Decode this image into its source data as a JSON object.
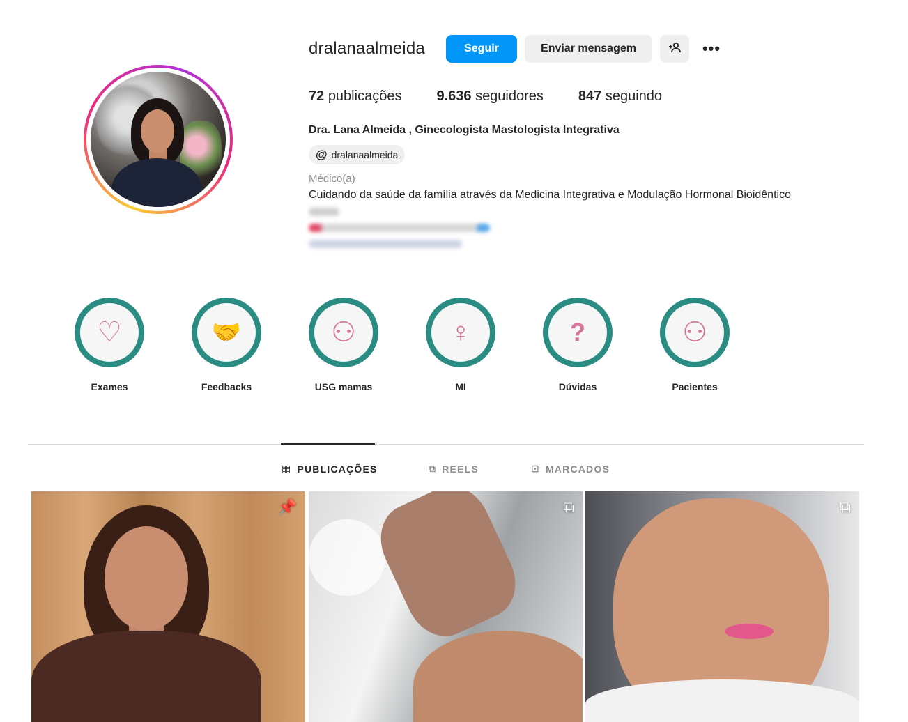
{
  "profile": {
    "username": "dralanaalmeida",
    "follow_label": "Seguir",
    "message_label": "Enviar mensagem",
    "add_user_icon": "+8",
    "more_icon": "•••",
    "stats": {
      "posts_count": "72",
      "posts_label": "publicações",
      "followers_count": "9.636",
      "followers_label": "seguidores",
      "following_count": "847",
      "following_label": "seguindo"
    },
    "full_name": "Dra. Lana Almeida , Ginecologista Mastologista Integrativa",
    "threads_handle": "dralanaalmeida",
    "category": "Médico(a)",
    "bio": "Cuidando da saúde da família através da Medicina Integrativa e Modulação Hormonal Bioidêntico"
  },
  "highlights": [
    {
      "label": "Exames",
      "icon": "heart-plus-icon",
      "glyph": "♡"
    },
    {
      "label": "Feedbacks",
      "icon": "handshake-icon",
      "glyph": "🤝"
    },
    {
      "label": "USG mamas",
      "icon": "woman-icon",
      "glyph": "⚇"
    },
    {
      "label": "MI",
      "icon": "female-symbol-icon",
      "glyph": "♀"
    },
    {
      "label": "Dúvidas",
      "icon": "question-bubble-icon",
      "glyph": "?"
    },
    {
      "label": "Pacientes",
      "icon": "woman-icon",
      "glyph": "⚇"
    }
  ],
  "tabs": [
    {
      "label": "PUBLICAÇÕES",
      "icon": "grid-icon",
      "glyph": "▦",
      "active": true
    },
    {
      "label": "REELS",
      "icon": "reels-icon",
      "glyph": "⧉",
      "active": false
    },
    {
      "label": "MARCADOS",
      "icon": "tagged-icon",
      "glyph": "⊡",
      "active": false
    }
  ],
  "posts": [
    {
      "badge_icon": "pin-icon",
      "badge_glyph": "📌"
    },
    {
      "badge_icon": "reel-icon",
      "badge_glyph": "⧉"
    },
    {
      "badge_icon": "reel-icon",
      "badge_glyph": "⧉"
    }
  ],
  "colors": {
    "follow_button": "#0095f6",
    "highlight_ring": "#2b8c84",
    "highlight_icon": "#d4749a"
  }
}
